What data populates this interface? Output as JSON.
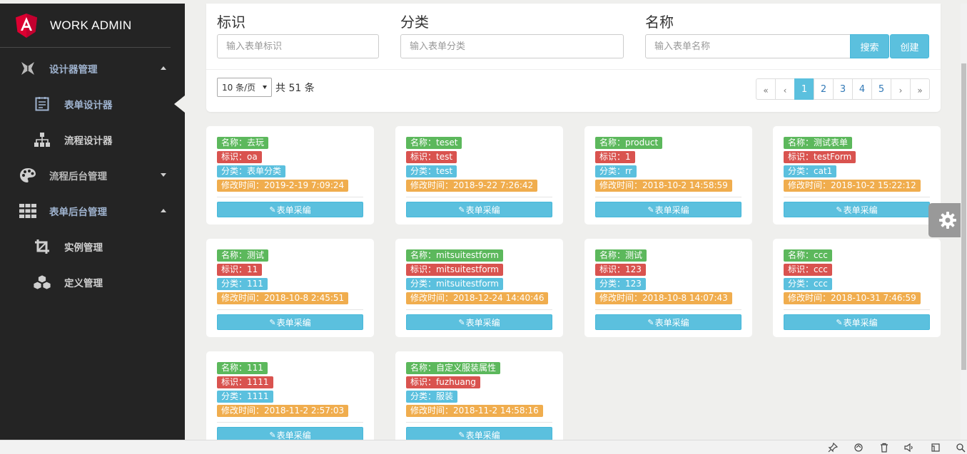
{
  "brand": {
    "title": "WORK ADMIN"
  },
  "sidebar": {
    "items": [
      {
        "label": "设计器管理",
        "icon": "designer-icon",
        "type": "top",
        "caret": "up"
      },
      {
        "label": "表单设计器",
        "icon": "form-icon",
        "type": "sub",
        "active": true
      },
      {
        "label": "流程设计器",
        "icon": "sitemap-icon",
        "type": "sub"
      },
      {
        "label": "流程后台管理",
        "icon": "palette-icon",
        "type": "top",
        "caret": "down"
      },
      {
        "label": "表单后台管理",
        "icon": "grid-icon",
        "type": "top",
        "caret": "up"
      },
      {
        "label": "实例管理",
        "icon": "crop-icon",
        "type": "sub"
      },
      {
        "label": "定义管理",
        "icon": "cubes-icon",
        "type": "sub"
      }
    ]
  },
  "search": {
    "id_label": "标识",
    "id_placeholder": "输入表单标识",
    "cat_label": "分类",
    "cat_placeholder": "输入表单分类",
    "name_label": "名称",
    "name_placeholder": "输入表单名称",
    "search_btn": "搜索",
    "create_btn": "创建"
  },
  "pagination": {
    "page_size": "10 条/页",
    "total": "共 51 条",
    "first": "«",
    "prev": "‹",
    "pages": [
      "1",
      "2",
      "3",
      "4",
      "5"
    ],
    "current": "1",
    "next": "›",
    "last": "»"
  },
  "cards": [
    {
      "name": "名称：去玩",
      "id": "标识：oa",
      "cat": "分类：表单分类",
      "time": "修改时间：2019-2-19 7:09:24",
      "btn": "表单采编"
    },
    {
      "name": "名称：teset",
      "id": "标识：test",
      "cat": "分类：test",
      "time": "修改时间：2018-9-22 7:26:42",
      "btn": "表单采编"
    },
    {
      "name": "名称：product",
      "id": "标识：1",
      "cat": "分类：rr",
      "time": "修改时间：2018-10-2 14:58:59",
      "btn": "表单采编"
    },
    {
      "name": "名称：测试表单",
      "id": "标识：testForm",
      "cat": "分类：cat1",
      "time": "修改时间：2018-10-2 15:22:12",
      "btn": "表单采编"
    },
    {
      "name": "名称：测试",
      "id": "标识：11",
      "cat": "分类：111",
      "time": "修改时间：2018-10-8 2:45:51",
      "btn": "表单采编"
    },
    {
      "name": "名称：mitsuitestform",
      "id": "标识：mitsuitestform",
      "cat": "分类：mitsuitestform",
      "time": "修改时间：2018-12-24 14:40:46",
      "btn": "表单采编"
    },
    {
      "name": "名称：测试",
      "id": "标识：123",
      "cat": "分类：123",
      "time": "修改时间：2018-10-8 14:07:43",
      "btn": "表单采编"
    },
    {
      "name": "名称：ccc",
      "id": "标识：ccc",
      "cat": "分类：ccc",
      "time": "修改时间：2018-10-31 7:46:59",
      "btn": "表单采编"
    },
    {
      "name": "名称：111",
      "id": "标识：1111",
      "cat": "分类：1111",
      "time": "修改时间：2018-11-2 2:57:03",
      "btn": "表单采编"
    },
    {
      "name": "名称：自定义服装属性",
      "id": "标识：fuzhuang",
      "cat": "分类：服装",
      "time": "修改时间：2018-11-2 14:58:16",
      "btn": "表单采编"
    }
  ],
  "colors": {
    "sidebar_bg": "#242424",
    "accent": "#5bc0de",
    "name_badge": "#5cb85c",
    "id_badge": "#d9534f",
    "cat_badge": "#5bc0de",
    "time_badge": "#f0ad4e"
  }
}
